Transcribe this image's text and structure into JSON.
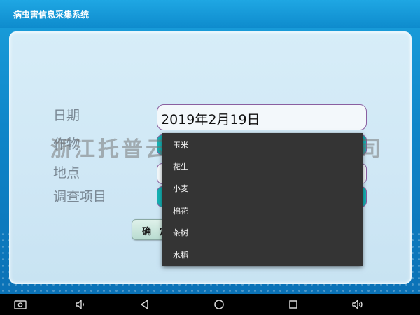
{
  "app": {
    "title": "病虫害信息采集系统"
  },
  "form": {
    "date_label": "日期",
    "date_value": "2019年2月19日",
    "crop_label": "作物",
    "place_label": "地点",
    "survey_label": "调查项目",
    "confirm_label": "确定"
  },
  "watermark": "浙江托普云农科技股份有限公司",
  "dropdown": {
    "options": [
      "玉米",
      "花生",
      "小麦",
      "棉花",
      "茶树",
      "水稻"
    ]
  },
  "navbar": {
    "icons": [
      "screenshot-icon",
      "volume-down-icon",
      "back-icon",
      "home-icon",
      "recents-icon",
      "volume-up-icon"
    ]
  },
  "colors": {
    "title_bar": "#1aa0dc",
    "panel": "#d7edf8",
    "select_teal": "#15b2b4",
    "dropdown_bg": "#343434",
    "field_border": "#8a5fa0"
  }
}
